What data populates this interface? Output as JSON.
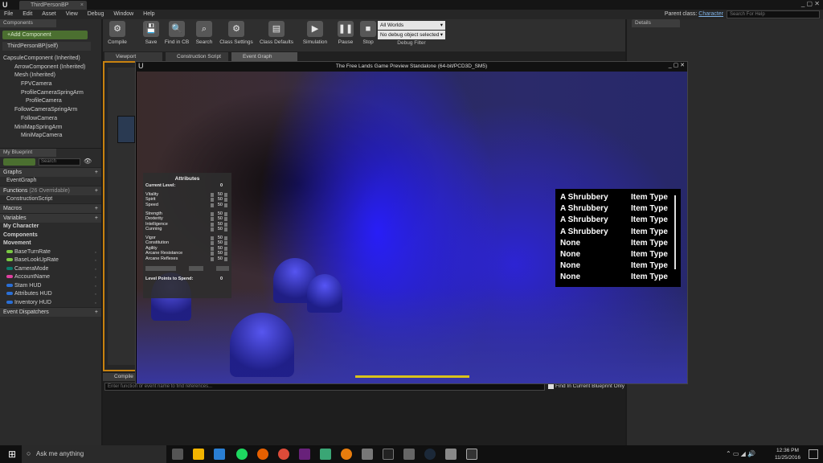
{
  "titlebar": {
    "tab_label": "ThirdPersonBP",
    "tab_close": "×",
    "window_controls": "_ ▢ ✕"
  },
  "menu": [
    "File",
    "Edit",
    "Asset",
    "View",
    "Debug",
    "Window",
    "Help"
  ],
  "parent_class": {
    "label": "Parent class:",
    "value": "Character"
  },
  "help_search": {
    "placeholder": "Search For Help"
  },
  "components": {
    "title": "Components",
    "add_button": "+Add Component",
    "self": "ThirdPersonBP(self)",
    "tree": [
      "CapsuleComponent (Inherited)",
      "ArrowComponent (Inherited)",
      "Mesh (Inherited)",
      "FPVCamera",
      "ProfileCameraSpringArm",
      "ProfileCamera",
      "FollowCameraSpringArm",
      "FollowCamera",
      "MiniMapSpringArm",
      "MiniMapCamera"
    ]
  },
  "my_blueprint": {
    "title": "My Blueprint",
    "search_placeholder": "Search",
    "sections": {
      "graphs": "Graphs",
      "event_graph": "EventGraph",
      "functions": "Functions",
      "functions_count": "(26 Overridable)",
      "construction_script": "ConstructionScript",
      "macros": "Macros",
      "variables": "Variables",
      "my_character": "My Character",
      "components": "Components",
      "movement": "Movement",
      "event_dispatchers": "Event Dispatchers"
    },
    "variables": [
      {
        "name": "BaseTurnRate",
        "color": "#7ac943"
      },
      {
        "name": "BaseLookUpRate",
        "color": "#7ac943"
      },
      {
        "name": "CameraMode",
        "color": "#0a7a6a"
      },
      {
        "name": "AccountName",
        "color": "#e040a0"
      },
      {
        "name": "Stam HUD",
        "color": "#2a6fd6"
      },
      {
        "name": "Attributes HUD",
        "color": "#2a6fd6"
      },
      {
        "name": "Inventory HUD",
        "color": "#2a6fd6"
      }
    ]
  },
  "toolbar": {
    "compile": "Compile",
    "save": "Save",
    "find_in_cb": "Find in CB",
    "search": "Search",
    "class_settings": "Class Settings",
    "class_defaults": "Class Defaults",
    "simulation": "Simulation",
    "pause": "Pause",
    "stop": "Stop",
    "world_select": "All Worlds",
    "debug_object": "No debug object selected",
    "debug_filter": "Debug Filter"
  },
  "editor_tabs": [
    "Viewport",
    "Construction Script",
    "Event Graph"
  ],
  "compile_results": {
    "tab": "Compile",
    "find_placeholder": "Enter function or event name to find references...",
    "find_option": "Find In Current Blueprint Only"
  },
  "details": {
    "title": "Details"
  },
  "game_window": {
    "title": "The Free Lands Game Preview Standalone (64-bit/PCD3D_SM5)",
    "controls": "_ ▢ ✕",
    "attributes": {
      "title": "Attributes",
      "current_level_label": "Current Level:",
      "current_level": "0",
      "groups": [
        [
          {
            "name": "Vitality",
            "value": "50"
          },
          {
            "name": "Spirit",
            "value": "50"
          },
          {
            "name": "Speed",
            "value": "50"
          }
        ],
        [
          {
            "name": "Strength",
            "value": "50"
          },
          {
            "name": "Dexterity",
            "value": "50"
          },
          {
            "name": "Intelligence",
            "value": "50"
          },
          {
            "name": "Cunning",
            "value": "50"
          }
        ],
        [
          {
            "name": "Vigor",
            "value": "50"
          },
          {
            "name": "Constitution",
            "value": "50"
          },
          {
            "name": "Agility",
            "value": "50"
          },
          {
            "name": "Arcane Resistance",
            "value": "50"
          },
          {
            "name": "Arcane Reflexes",
            "value": "50"
          }
        ]
      ],
      "points_label": "Level Points to Spend:",
      "points": "0"
    },
    "inventory": [
      {
        "item": "A Shrubbery",
        "type": "Item Type"
      },
      {
        "item": "A Shrubbery",
        "type": "Item Type"
      },
      {
        "item": "A Shrubbery",
        "type": "Item Type"
      },
      {
        "item": "A Shrubbery",
        "type": "Item Type"
      },
      {
        "item": "None",
        "type": "Item Type"
      },
      {
        "item": "None",
        "type": "Item Type"
      },
      {
        "item": "None",
        "type": "Item Type"
      },
      {
        "item": "None",
        "type": "Item Type"
      }
    ]
  },
  "taskbar": {
    "search_placeholder": "Ask me anything",
    "time": "12:36 PM",
    "date": "11/25/2016"
  }
}
